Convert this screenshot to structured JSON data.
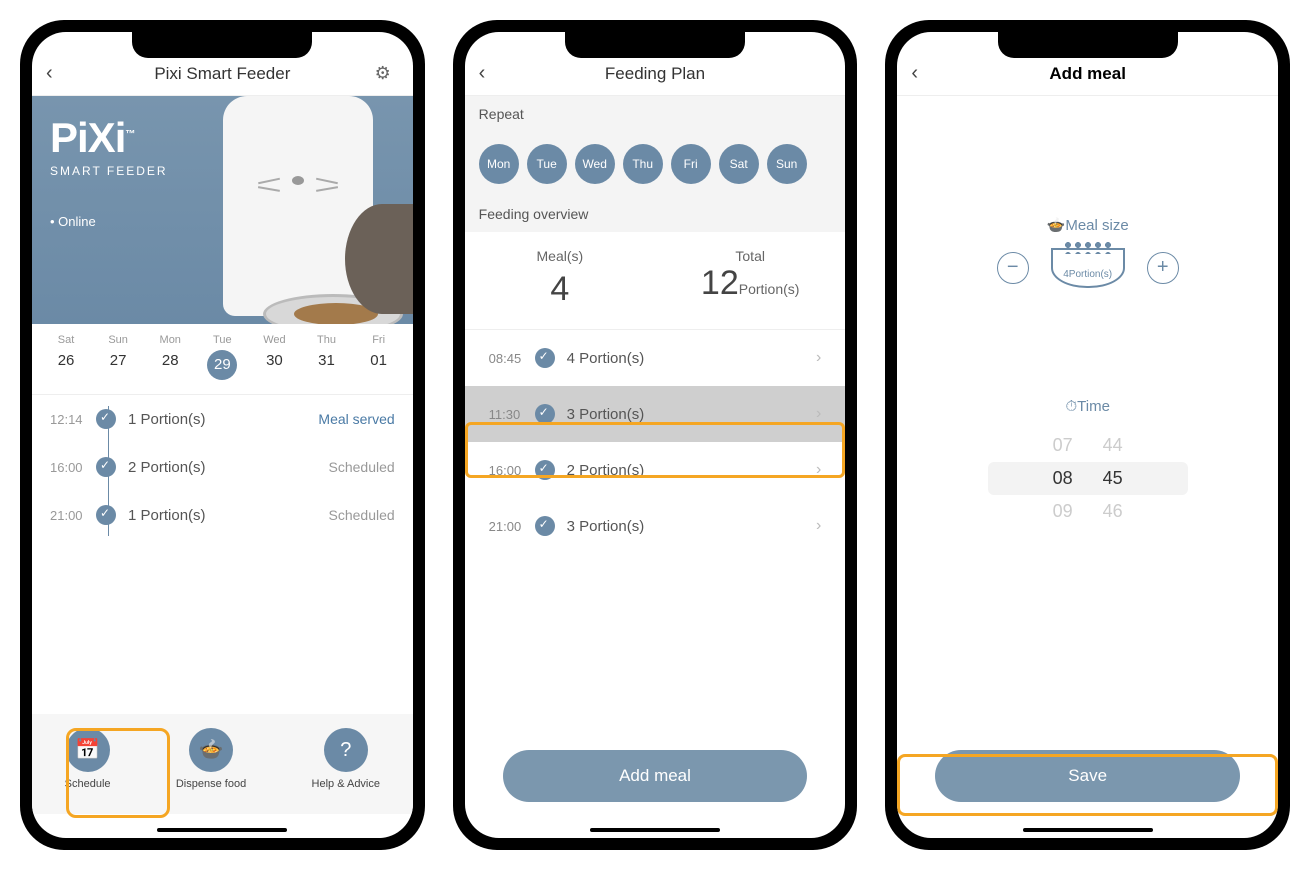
{
  "colors": {
    "accent": "#6b8aa6",
    "highlight": "#f5a623"
  },
  "screen1": {
    "title": "Pixi Smart Feeder",
    "brand": "PiXi",
    "subbrand": "SMART FEEDER",
    "status": "Online",
    "calendar": [
      {
        "dow": "Sat",
        "num": "26",
        "selected": false
      },
      {
        "dow": "Sun",
        "num": "27",
        "selected": false
      },
      {
        "dow": "Mon",
        "num": "28",
        "selected": false
      },
      {
        "dow": "Tue",
        "num": "29",
        "selected": true
      },
      {
        "dow": "Wed",
        "num": "30",
        "selected": false
      },
      {
        "dow": "Thu",
        "num": "31",
        "selected": false
      },
      {
        "dow": "Fri",
        "num": "01",
        "selected": false
      }
    ],
    "today": [
      {
        "time": "12:14",
        "portions": "1 Portion(s)",
        "status": "Meal served",
        "served": true
      },
      {
        "time": "16:00",
        "portions": "2 Portion(s)",
        "status": "Scheduled",
        "served": false
      },
      {
        "time": "21:00",
        "portions": "1 Portion(s)",
        "status": "Scheduled",
        "served": false
      }
    ],
    "actions": [
      {
        "label": "Schedule",
        "icon": "calendar-icon"
      },
      {
        "label": "Dispense food",
        "icon": "bowl-icon"
      },
      {
        "label": "Help & Advice",
        "icon": "help-icon"
      }
    ]
  },
  "screen2": {
    "title": "Feeding Plan",
    "repeat_label": "Repeat",
    "days": [
      "Mon",
      "Tue",
      "Wed",
      "Thu",
      "Fri",
      "Sat",
      "Sun"
    ],
    "overview_label": "Feeding overview",
    "meals_label": "Meal(s)",
    "meals_count": "4",
    "total_label": "Total",
    "total_count": "12",
    "total_unit": "Portion(s)",
    "plan": [
      {
        "time": "08:45",
        "portions": "4 Portion(s)",
        "highlighted": false
      },
      {
        "time": "11:30",
        "portions": "3 Portion(s)",
        "highlighted": true
      },
      {
        "time": "16:00",
        "portions": "2 Portion(s)",
        "highlighted": false
      },
      {
        "time": "21:00",
        "portions": "3 Portion(s)",
        "highlighted": false
      }
    ],
    "add_button": "Add meal"
  },
  "screen3": {
    "title": "Add meal",
    "meal_size_label": "Meal size",
    "portion_value": "4Portion(s)",
    "time_label": "Time",
    "time_prev_h": "07",
    "time_prev_m": "44",
    "time_sel_h": "08",
    "time_sel_m": "45",
    "time_next_h": "09",
    "time_next_m": "46",
    "save_button": "Save"
  }
}
